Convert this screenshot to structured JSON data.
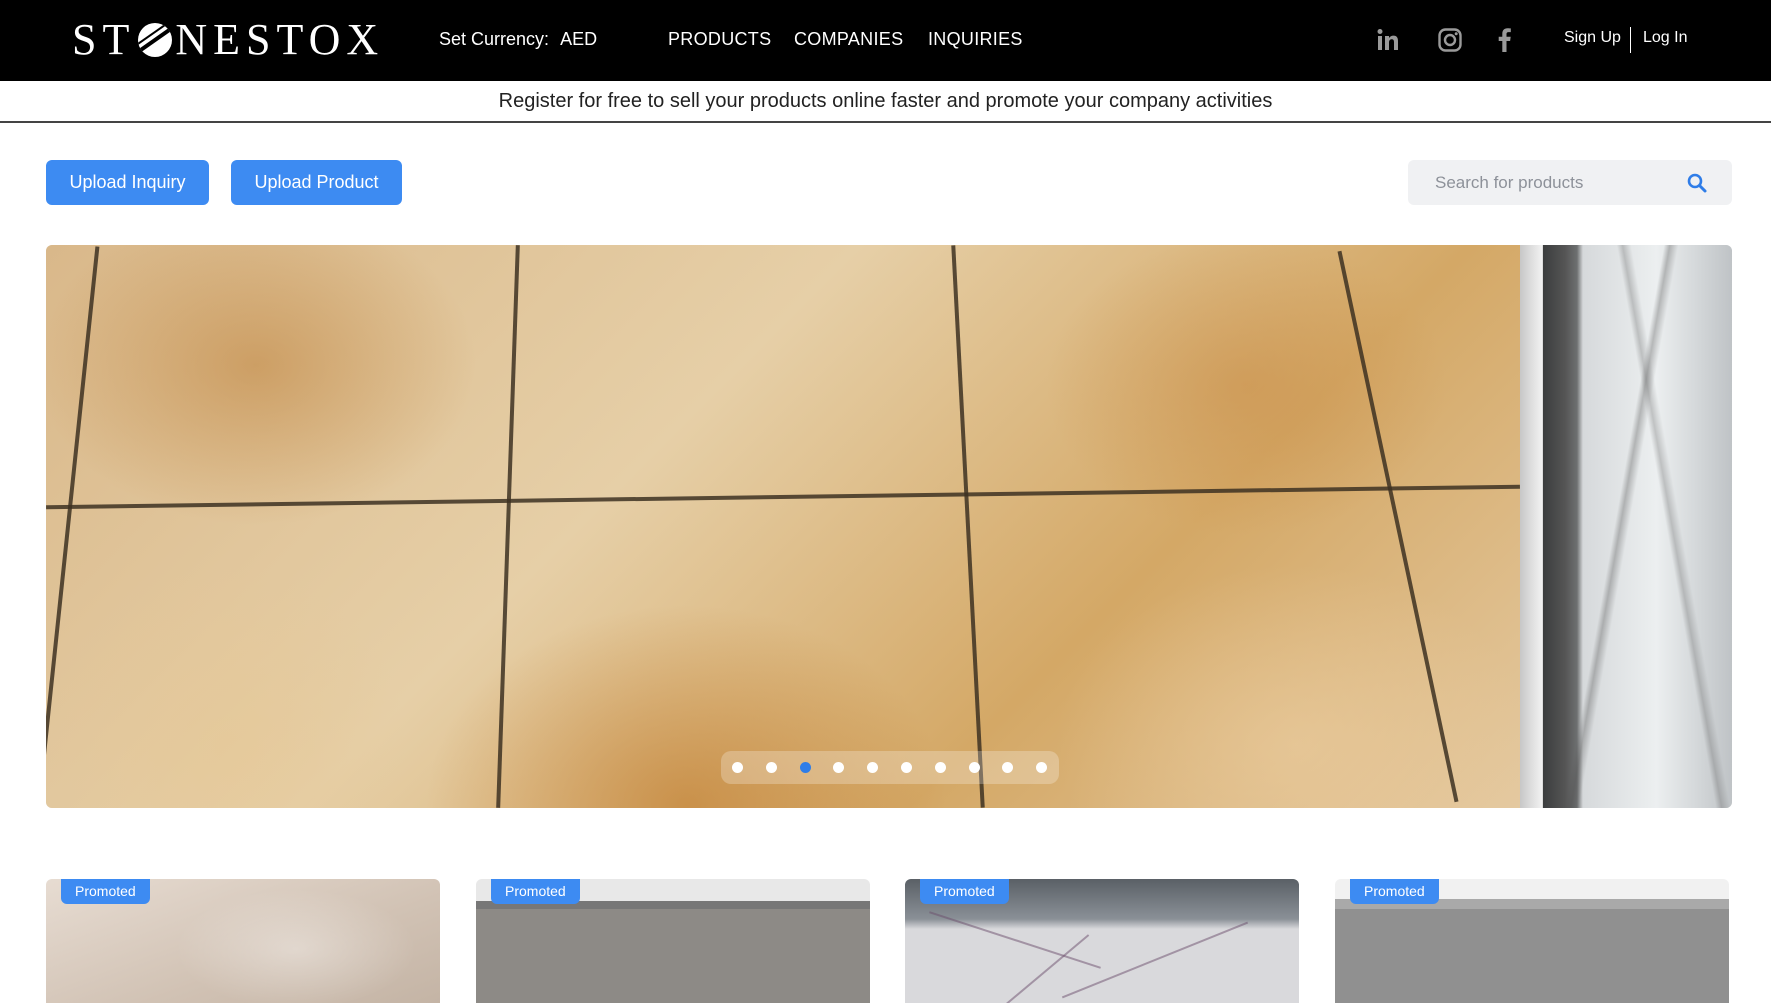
{
  "header": {
    "logo": "STONESTOX",
    "currency_label": "Set Currency:",
    "currency_value": "AED",
    "nav": [
      "PRODUCTS",
      "COMPANIES",
      "INQUIRIES"
    ],
    "social_icons": [
      "linkedin-icon",
      "instagram-icon",
      "facebook-icon"
    ],
    "sign_up": "Sign Up",
    "log_in": "Log In"
  },
  "banner": {
    "text": "Register for free to sell your products online faster and promote your company activities"
  },
  "actions": {
    "upload_inquiry": "Upload Inquiry",
    "upload_product": "Upload Product"
  },
  "search": {
    "placeholder": "Search for products",
    "value": ""
  },
  "carousel": {
    "dot_count": 10,
    "active_index": 2
  },
  "products": [
    {
      "badge": "Promoted"
    },
    {
      "badge": "Promoted"
    },
    {
      "badge": "Promoted"
    },
    {
      "badge": "Promoted"
    }
  ],
  "colors": {
    "accent": "#3d8bf2",
    "navbar": "#000000"
  }
}
